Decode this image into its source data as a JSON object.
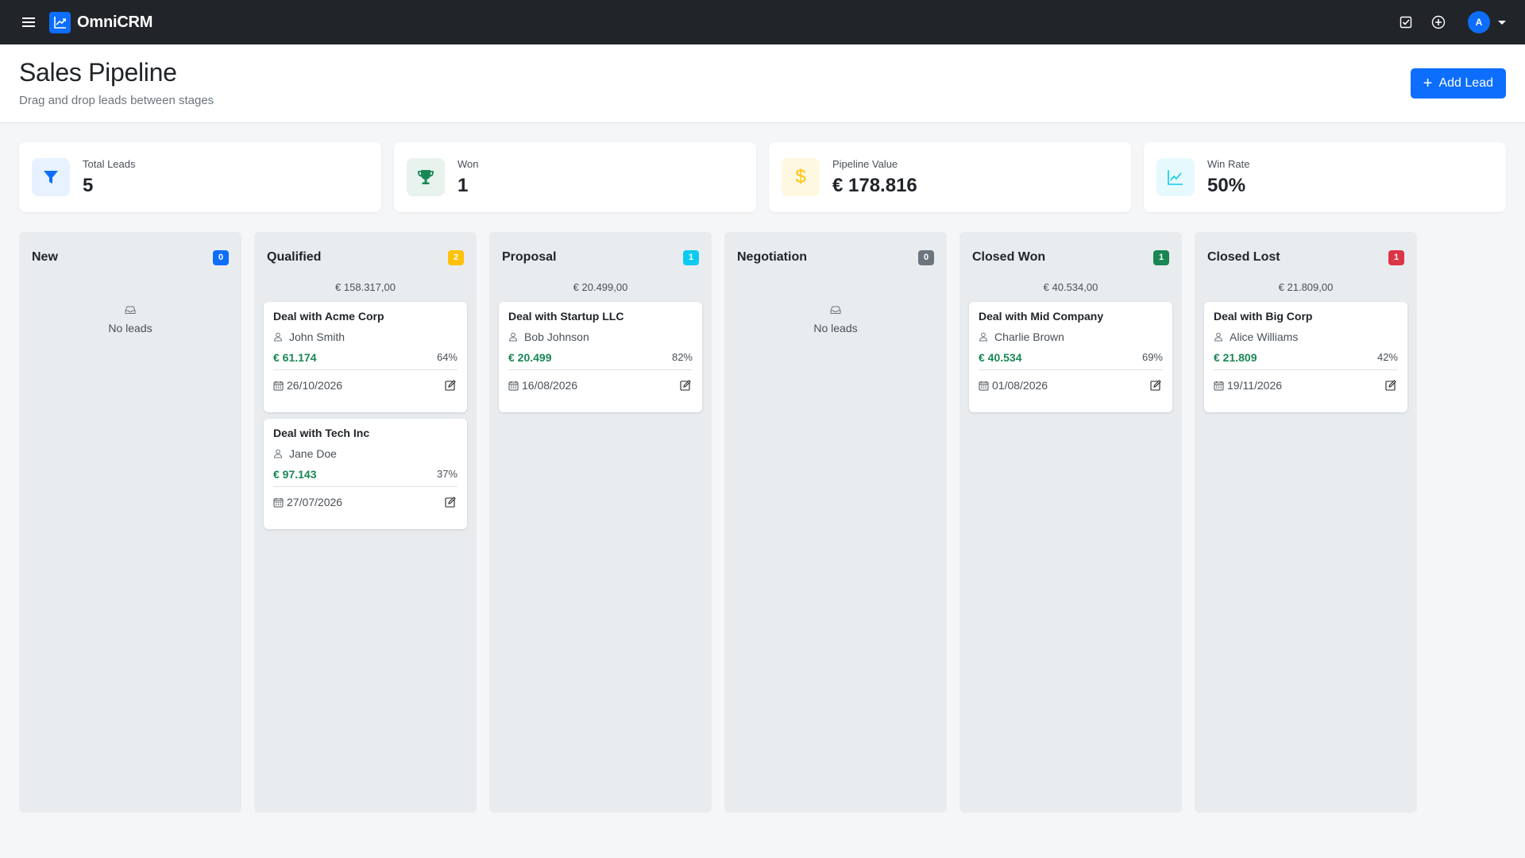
{
  "app": {
    "name": "OmniCRM",
    "avatar_initial": "A"
  },
  "colors": {
    "primary": "#0d6efd",
    "success": "#198754",
    "warning": "#ffc107",
    "info": "#0dcaf0",
    "secondary": "#6c757d",
    "danger": "#dc3545"
  },
  "header": {
    "title": "Sales Pipeline",
    "subtitle": "Drag and drop leads between stages",
    "add_label": "Add Lead"
  },
  "stats": [
    {
      "label": "Total Leads",
      "value": "5",
      "icon": "funnel-icon"
    },
    {
      "label": "Won",
      "value": "1",
      "icon": "trophy-icon"
    },
    {
      "label": "Pipeline Value",
      "value": "€ 178.816",
      "icon": "dollar-icon"
    },
    {
      "label": "Win Rate",
      "value": "50%",
      "icon": "chart-line-icon"
    }
  ],
  "columns": [
    {
      "title": "New",
      "count": "0",
      "badge_color": "#0d6efd",
      "total": "",
      "empty_text": "No leads",
      "cards": []
    },
    {
      "title": "Qualified",
      "count": "2",
      "badge_color": "#ffc107",
      "total": "€ 158.317,00",
      "cards": [
        {
          "title": "Deal with Acme Corp",
          "contact": "John Smith",
          "amount": "€ 61.174",
          "probability": "64%",
          "date": "26/10/2026"
        },
        {
          "title": "Deal with Tech Inc",
          "contact": "Jane Doe",
          "amount": "€ 97.143",
          "probability": "37%",
          "date": "27/07/2026"
        }
      ]
    },
    {
      "title": "Proposal",
      "count": "1",
      "badge_color": "#0dcaf0",
      "total": "€ 20.499,00",
      "cards": [
        {
          "title": "Deal with Startup LLC",
          "contact": "Bob Johnson",
          "amount": "€ 20.499",
          "probability": "82%",
          "date": "16/08/2026"
        }
      ]
    },
    {
      "title": "Negotiation",
      "count": "0",
      "badge_color": "#6c757d",
      "total": "",
      "empty_text": "No leads",
      "cards": []
    },
    {
      "title": "Closed Won",
      "count": "1",
      "badge_color": "#198754",
      "total": "€ 40.534,00",
      "cards": [
        {
          "title": "Deal with Mid Company",
          "contact": "Charlie Brown",
          "amount": "€ 40.534",
          "probability": "69%",
          "date": "01/08/2026"
        }
      ]
    },
    {
      "title": "Closed Lost",
      "count": "1",
      "badge_color": "#dc3545",
      "total": "€ 21.809,00",
      "cards": [
        {
          "title": "Deal with Big Corp",
          "contact": "Alice Williams",
          "amount": "€ 21.809",
          "probability": "42%",
          "date": "19/11/2026"
        }
      ]
    }
  ]
}
